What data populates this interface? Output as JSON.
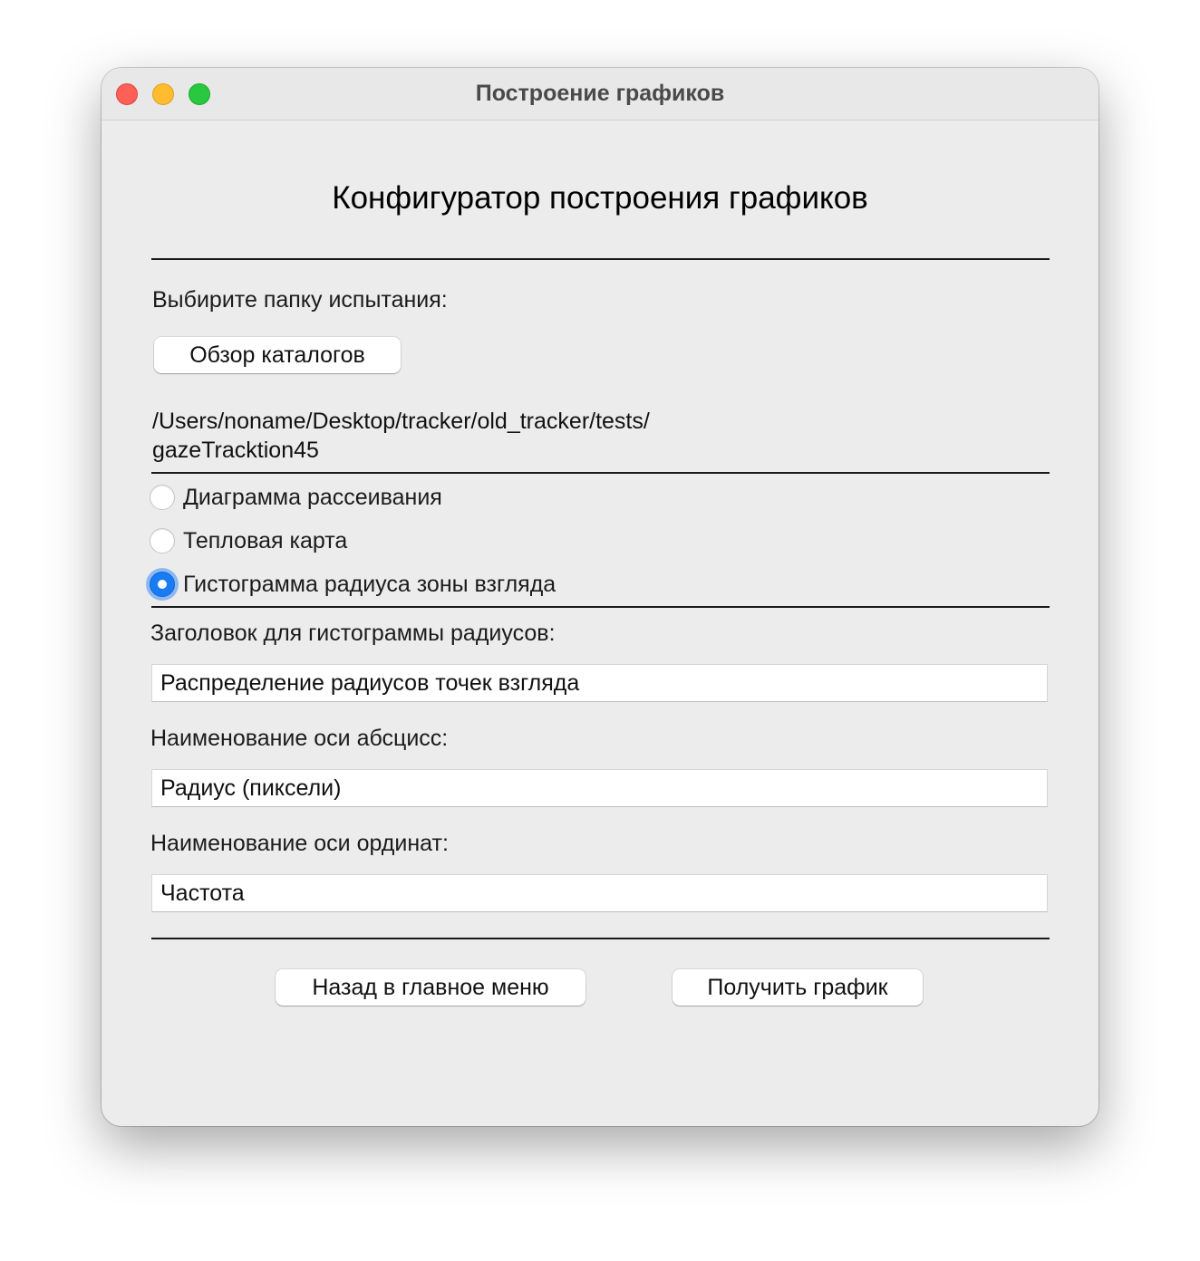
{
  "window": {
    "title": "Построение графиков"
  },
  "heading": "Конфигуратор построения графиков",
  "folder": {
    "label": "Выбирите папку испытания:",
    "browse_button": "Обзор каталогов",
    "path_line1": "/Users/noname/Desktop/tracker/old_tracker/tests/",
    "path_line2": "gazeTracktion45"
  },
  "chart_types": [
    {
      "label": "Диаграмма рассеивания",
      "selected": false
    },
    {
      "label": "Тепловая карта",
      "selected": false
    },
    {
      "label": "Гистограмма радиуса зоны взгляда",
      "selected": true
    }
  ],
  "fields": {
    "title_label": "Заголовок для гистограммы радиусов:",
    "title_value": "Распределение радиусов точек взгляда",
    "xaxis_label": "Наименование оси абсцисс:",
    "xaxis_value": "Радиус (пиксели)",
    "yaxis_label": "Наименование оси ординат:",
    "yaxis_value": "Частота"
  },
  "actions": {
    "back_button": "Назад в главное меню",
    "plot_button": "Получить график"
  },
  "colors": {
    "accent": "#1a7cf5",
    "window_bg": "#ececec",
    "close": "#fe5f57",
    "minimize": "#febc2e",
    "maximize": "#28c840"
  }
}
